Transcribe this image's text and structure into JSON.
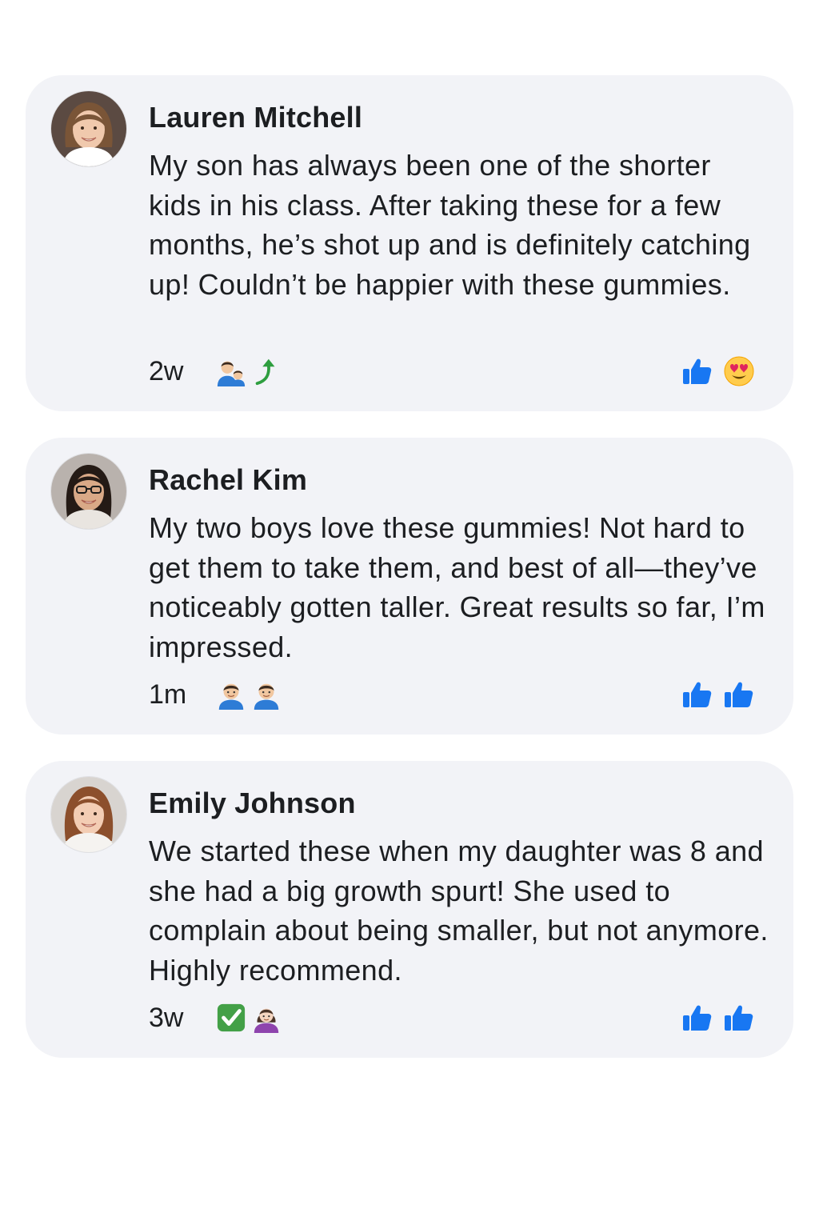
{
  "comments": [
    {
      "author": "Lauren Mitchell",
      "text": "My son has always been one of the shorter kids in his class. After taking these for a few months, he’s shot up and is definitely catching up! Couldn’t be happier with these gummies.",
      "time": "2w",
      "avatar": "woman-smiling-brown-hair",
      "emojis": [
        "man-with-child-icon",
        "up-arrow-icon"
      ],
      "reactions": [
        "like-icon",
        "heart-eyes-icon"
      ]
    },
    {
      "author": "Rachel Kim",
      "text": "My two boys love these gummies! Not hard to get them to take them, and best of all—they’ve noticeably gotten taller. Great results so far, I’m impressed.",
      "time": "1m",
      "avatar": "woman-with-glasses-dark-hair",
      "emojis": [
        "boy-icon",
        "boy-icon"
      ],
      "reactions": [
        "like-icon",
        "like-icon"
      ]
    },
    {
      "author": "Emily Johnson",
      "text": "We started these when my daughter was 8 and she had a big growth spurt! She used to complain about being smaller, but not anymore. Highly recommend.",
      "time": "3w",
      "avatar": "woman-smiling-auburn-hair",
      "emojis": [
        "check-mark-icon",
        "girl-icon"
      ],
      "reactions": [
        "like-icon",
        "like-icon"
      ]
    }
  ],
  "colors": {
    "bubble": "#f2f3f7",
    "like_blue": "#1877f2",
    "text": "#1c1e21"
  }
}
